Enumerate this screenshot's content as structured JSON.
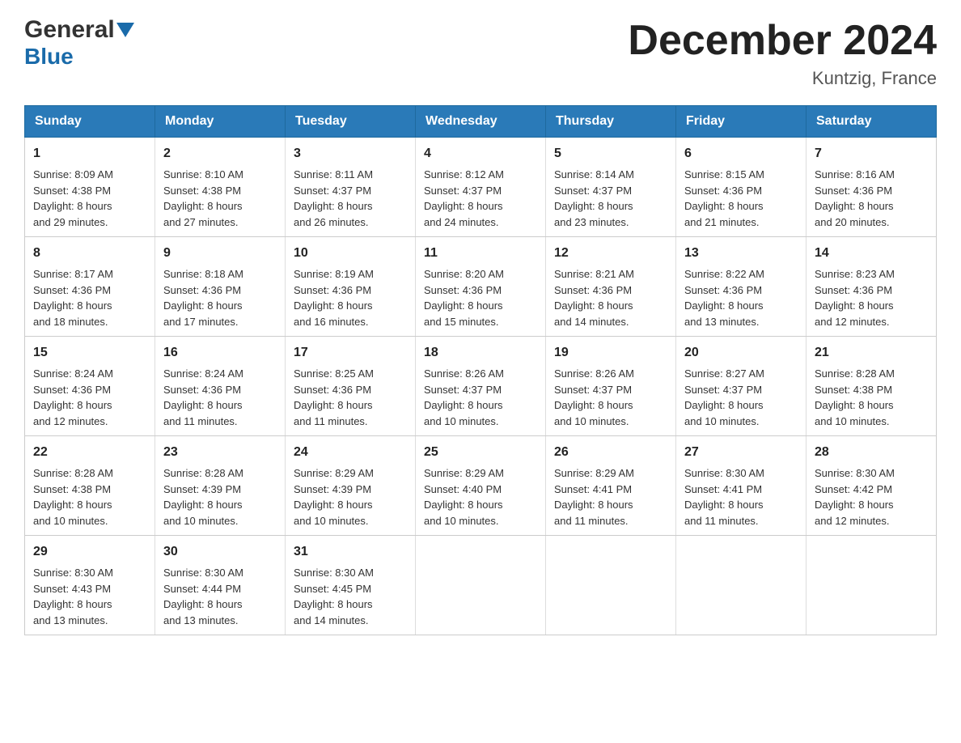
{
  "header": {
    "logo_general": "General",
    "logo_blue": "Blue",
    "month_title": "December 2024",
    "location": "Kuntzig, France"
  },
  "days_of_week": [
    "Sunday",
    "Monday",
    "Tuesday",
    "Wednesday",
    "Thursday",
    "Friday",
    "Saturday"
  ],
  "weeks": [
    [
      {
        "day": "1",
        "sunrise": "8:09 AM",
        "sunset": "4:38 PM",
        "daylight": "8 hours and 29 minutes."
      },
      {
        "day": "2",
        "sunrise": "8:10 AM",
        "sunset": "4:38 PM",
        "daylight": "8 hours and 27 minutes."
      },
      {
        "day": "3",
        "sunrise": "8:11 AM",
        "sunset": "4:37 PM",
        "daylight": "8 hours and 26 minutes."
      },
      {
        "day": "4",
        "sunrise": "8:12 AM",
        "sunset": "4:37 PM",
        "daylight": "8 hours and 24 minutes."
      },
      {
        "day": "5",
        "sunrise": "8:14 AM",
        "sunset": "4:37 PM",
        "daylight": "8 hours and 23 minutes."
      },
      {
        "day": "6",
        "sunrise": "8:15 AM",
        "sunset": "4:36 PM",
        "daylight": "8 hours and 21 minutes."
      },
      {
        "day": "7",
        "sunrise": "8:16 AM",
        "sunset": "4:36 PM",
        "daylight": "8 hours and 20 minutes."
      }
    ],
    [
      {
        "day": "8",
        "sunrise": "8:17 AM",
        "sunset": "4:36 PM",
        "daylight": "8 hours and 18 minutes."
      },
      {
        "day": "9",
        "sunrise": "8:18 AM",
        "sunset": "4:36 PM",
        "daylight": "8 hours and 17 minutes."
      },
      {
        "day": "10",
        "sunrise": "8:19 AM",
        "sunset": "4:36 PM",
        "daylight": "8 hours and 16 minutes."
      },
      {
        "day": "11",
        "sunrise": "8:20 AM",
        "sunset": "4:36 PM",
        "daylight": "8 hours and 15 minutes."
      },
      {
        "day": "12",
        "sunrise": "8:21 AM",
        "sunset": "4:36 PM",
        "daylight": "8 hours and 14 minutes."
      },
      {
        "day": "13",
        "sunrise": "8:22 AM",
        "sunset": "4:36 PM",
        "daylight": "8 hours and 13 minutes."
      },
      {
        "day": "14",
        "sunrise": "8:23 AM",
        "sunset": "4:36 PM",
        "daylight": "8 hours and 12 minutes."
      }
    ],
    [
      {
        "day": "15",
        "sunrise": "8:24 AM",
        "sunset": "4:36 PM",
        "daylight": "8 hours and 12 minutes."
      },
      {
        "day": "16",
        "sunrise": "8:24 AM",
        "sunset": "4:36 PM",
        "daylight": "8 hours and 11 minutes."
      },
      {
        "day": "17",
        "sunrise": "8:25 AM",
        "sunset": "4:36 PM",
        "daylight": "8 hours and 11 minutes."
      },
      {
        "day": "18",
        "sunrise": "8:26 AM",
        "sunset": "4:37 PM",
        "daylight": "8 hours and 10 minutes."
      },
      {
        "day": "19",
        "sunrise": "8:26 AM",
        "sunset": "4:37 PM",
        "daylight": "8 hours and 10 minutes."
      },
      {
        "day": "20",
        "sunrise": "8:27 AM",
        "sunset": "4:37 PM",
        "daylight": "8 hours and 10 minutes."
      },
      {
        "day": "21",
        "sunrise": "8:28 AM",
        "sunset": "4:38 PM",
        "daylight": "8 hours and 10 minutes."
      }
    ],
    [
      {
        "day": "22",
        "sunrise": "8:28 AM",
        "sunset": "4:38 PM",
        "daylight": "8 hours and 10 minutes."
      },
      {
        "day": "23",
        "sunrise": "8:28 AM",
        "sunset": "4:39 PM",
        "daylight": "8 hours and 10 minutes."
      },
      {
        "day": "24",
        "sunrise": "8:29 AM",
        "sunset": "4:39 PM",
        "daylight": "8 hours and 10 minutes."
      },
      {
        "day": "25",
        "sunrise": "8:29 AM",
        "sunset": "4:40 PM",
        "daylight": "8 hours and 10 minutes."
      },
      {
        "day": "26",
        "sunrise": "8:29 AM",
        "sunset": "4:41 PM",
        "daylight": "8 hours and 11 minutes."
      },
      {
        "day": "27",
        "sunrise": "8:30 AM",
        "sunset": "4:41 PM",
        "daylight": "8 hours and 11 minutes."
      },
      {
        "day": "28",
        "sunrise": "8:30 AM",
        "sunset": "4:42 PM",
        "daylight": "8 hours and 12 minutes."
      }
    ],
    [
      {
        "day": "29",
        "sunrise": "8:30 AM",
        "sunset": "4:43 PM",
        "daylight": "8 hours and 13 minutes."
      },
      {
        "day": "30",
        "sunrise": "8:30 AM",
        "sunset": "4:44 PM",
        "daylight": "8 hours and 13 minutes."
      },
      {
        "day": "31",
        "sunrise": "8:30 AM",
        "sunset": "4:45 PM",
        "daylight": "8 hours and 14 minutes."
      },
      null,
      null,
      null,
      null
    ]
  ],
  "labels": {
    "sunrise": "Sunrise:",
    "sunset": "Sunset:",
    "daylight": "Daylight:"
  },
  "accent_color": "#2a7ab8"
}
